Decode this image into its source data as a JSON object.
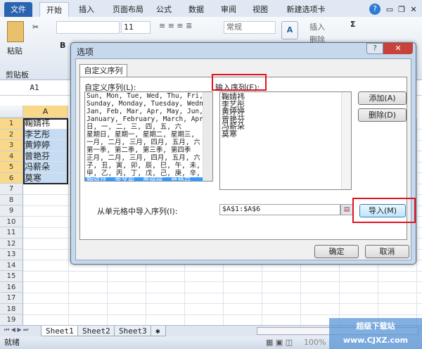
{
  "ribbon": {
    "tabs": [
      "文件",
      "开始",
      "插入",
      "页面布局",
      "公式",
      "数据",
      "审阅",
      "视图",
      "新建选项卡"
    ],
    "font_size": "11",
    "number_format": "常规",
    "paste_label": "粘贴",
    "clipboard_group": "剪贴板",
    "insert_label": "插入",
    "delete_label": "删除"
  },
  "name_box": "A1",
  "sheet": {
    "column": "A",
    "rows": [
      "1",
      "2",
      "3",
      "4",
      "5",
      "6",
      "7",
      "8",
      "9",
      "10",
      "11",
      "12",
      "13",
      "14",
      "15",
      "16",
      "17",
      "18",
      "19"
    ],
    "cells": [
      "鞠婧祎",
      "李艺彤",
      "黄婷婷",
      "曾艳芬",
      "冯薪朵",
      "莫寒"
    ]
  },
  "sheet_tabs": [
    "Sheet1",
    "Sheet2",
    "Sheet3"
  ],
  "status": {
    "ready": "就绪",
    "zoom": "100%"
  },
  "watermark": "超级下载站 www.CJXZ.com",
  "dialog": {
    "title": "选项",
    "tab": "自定义序列",
    "lists_label": "自定义序列(L):",
    "entries_label": "输入序列(E):",
    "lists": [
      "Sun, Mon, Tue, Wed, Thu, Fri, S",
      "Sunday, Monday, Tuesday, Wednes",
      "Jan, Feb, Mar, Apr, May, Jun, J",
      "January, February, March, April",
      "日, 一, 二, 三, 四, 五, 六",
      "星期日, 星期一, 星期二, 星期三,",
      "一月, 二月, 三月, 四月, 五月, 六",
      "第一季, 第二季, 第三季, 第四季",
      "正月, 二月, 三月, 四月, 五月, 六",
      "子, 丑, 寅, 卯, 辰, 巳, 午, 未,",
      "甲, 乙, 丙, 丁, 戊, 己, 庚, 辛,",
      "鞠婧祎, 李艺彤, 黄婷婷, 曾艳芬,"
    ],
    "entries": [
      "鞠婧祎",
      "李艺彤",
      "黄婷婷",
      "曾艳芬",
      "冯薪朵",
      "莫寒"
    ],
    "add": "添加(A)",
    "delete": "删除(D)",
    "import_label": "从单元格中导入序列(I):",
    "import_range": "$A$1:$A$6",
    "import": "导入(M)",
    "ok": "确定",
    "cancel": "取消"
  }
}
